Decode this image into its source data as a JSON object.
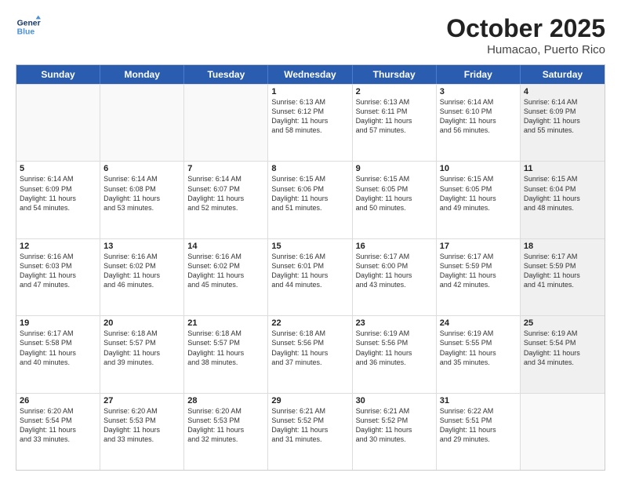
{
  "header": {
    "logo_line1": "General",
    "logo_line2": "Blue",
    "month": "October 2025",
    "location": "Humacao, Puerto Rico"
  },
  "weekdays": [
    "Sunday",
    "Monday",
    "Tuesday",
    "Wednesday",
    "Thursday",
    "Friday",
    "Saturday"
  ],
  "weeks": [
    [
      {
        "day": "",
        "info": ""
      },
      {
        "day": "",
        "info": ""
      },
      {
        "day": "",
        "info": ""
      },
      {
        "day": "1",
        "info": "Sunrise: 6:13 AM\nSunset: 6:12 PM\nDaylight: 11 hours\nand 58 minutes."
      },
      {
        "day": "2",
        "info": "Sunrise: 6:13 AM\nSunset: 6:11 PM\nDaylight: 11 hours\nand 57 minutes."
      },
      {
        "day": "3",
        "info": "Sunrise: 6:14 AM\nSunset: 6:10 PM\nDaylight: 11 hours\nand 56 minutes."
      },
      {
        "day": "4",
        "info": "Sunrise: 6:14 AM\nSunset: 6:09 PM\nDaylight: 11 hours\nand 55 minutes."
      }
    ],
    [
      {
        "day": "5",
        "info": "Sunrise: 6:14 AM\nSunset: 6:09 PM\nDaylight: 11 hours\nand 54 minutes."
      },
      {
        "day": "6",
        "info": "Sunrise: 6:14 AM\nSunset: 6:08 PM\nDaylight: 11 hours\nand 53 minutes."
      },
      {
        "day": "7",
        "info": "Sunrise: 6:14 AM\nSunset: 6:07 PM\nDaylight: 11 hours\nand 52 minutes."
      },
      {
        "day": "8",
        "info": "Sunrise: 6:15 AM\nSunset: 6:06 PM\nDaylight: 11 hours\nand 51 minutes."
      },
      {
        "day": "9",
        "info": "Sunrise: 6:15 AM\nSunset: 6:05 PM\nDaylight: 11 hours\nand 50 minutes."
      },
      {
        "day": "10",
        "info": "Sunrise: 6:15 AM\nSunset: 6:05 PM\nDaylight: 11 hours\nand 49 minutes."
      },
      {
        "day": "11",
        "info": "Sunrise: 6:15 AM\nSunset: 6:04 PM\nDaylight: 11 hours\nand 48 minutes."
      }
    ],
    [
      {
        "day": "12",
        "info": "Sunrise: 6:16 AM\nSunset: 6:03 PM\nDaylight: 11 hours\nand 47 minutes."
      },
      {
        "day": "13",
        "info": "Sunrise: 6:16 AM\nSunset: 6:02 PM\nDaylight: 11 hours\nand 46 minutes."
      },
      {
        "day": "14",
        "info": "Sunrise: 6:16 AM\nSunset: 6:02 PM\nDaylight: 11 hours\nand 45 minutes."
      },
      {
        "day": "15",
        "info": "Sunrise: 6:16 AM\nSunset: 6:01 PM\nDaylight: 11 hours\nand 44 minutes."
      },
      {
        "day": "16",
        "info": "Sunrise: 6:17 AM\nSunset: 6:00 PM\nDaylight: 11 hours\nand 43 minutes."
      },
      {
        "day": "17",
        "info": "Sunrise: 6:17 AM\nSunset: 5:59 PM\nDaylight: 11 hours\nand 42 minutes."
      },
      {
        "day": "18",
        "info": "Sunrise: 6:17 AM\nSunset: 5:59 PM\nDaylight: 11 hours\nand 41 minutes."
      }
    ],
    [
      {
        "day": "19",
        "info": "Sunrise: 6:17 AM\nSunset: 5:58 PM\nDaylight: 11 hours\nand 40 minutes."
      },
      {
        "day": "20",
        "info": "Sunrise: 6:18 AM\nSunset: 5:57 PM\nDaylight: 11 hours\nand 39 minutes."
      },
      {
        "day": "21",
        "info": "Sunrise: 6:18 AM\nSunset: 5:57 PM\nDaylight: 11 hours\nand 38 minutes."
      },
      {
        "day": "22",
        "info": "Sunrise: 6:18 AM\nSunset: 5:56 PM\nDaylight: 11 hours\nand 37 minutes."
      },
      {
        "day": "23",
        "info": "Sunrise: 6:19 AM\nSunset: 5:56 PM\nDaylight: 11 hours\nand 36 minutes."
      },
      {
        "day": "24",
        "info": "Sunrise: 6:19 AM\nSunset: 5:55 PM\nDaylight: 11 hours\nand 35 minutes."
      },
      {
        "day": "25",
        "info": "Sunrise: 6:19 AM\nSunset: 5:54 PM\nDaylight: 11 hours\nand 34 minutes."
      }
    ],
    [
      {
        "day": "26",
        "info": "Sunrise: 6:20 AM\nSunset: 5:54 PM\nDaylight: 11 hours\nand 33 minutes."
      },
      {
        "day": "27",
        "info": "Sunrise: 6:20 AM\nSunset: 5:53 PM\nDaylight: 11 hours\nand 33 minutes."
      },
      {
        "day": "28",
        "info": "Sunrise: 6:20 AM\nSunset: 5:53 PM\nDaylight: 11 hours\nand 32 minutes."
      },
      {
        "day": "29",
        "info": "Sunrise: 6:21 AM\nSunset: 5:52 PM\nDaylight: 11 hours\nand 31 minutes."
      },
      {
        "day": "30",
        "info": "Sunrise: 6:21 AM\nSunset: 5:52 PM\nDaylight: 11 hours\nand 30 minutes."
      },
      {
        "day": "31",
        "info": "Sunrise: 6:22 AM\nSunset: 5:51 PM\nDaylight: 11 hours\nand 29 minutes."
      },
      {
        "day": "",
        "info": ""
      }
    ]
  ]
}
